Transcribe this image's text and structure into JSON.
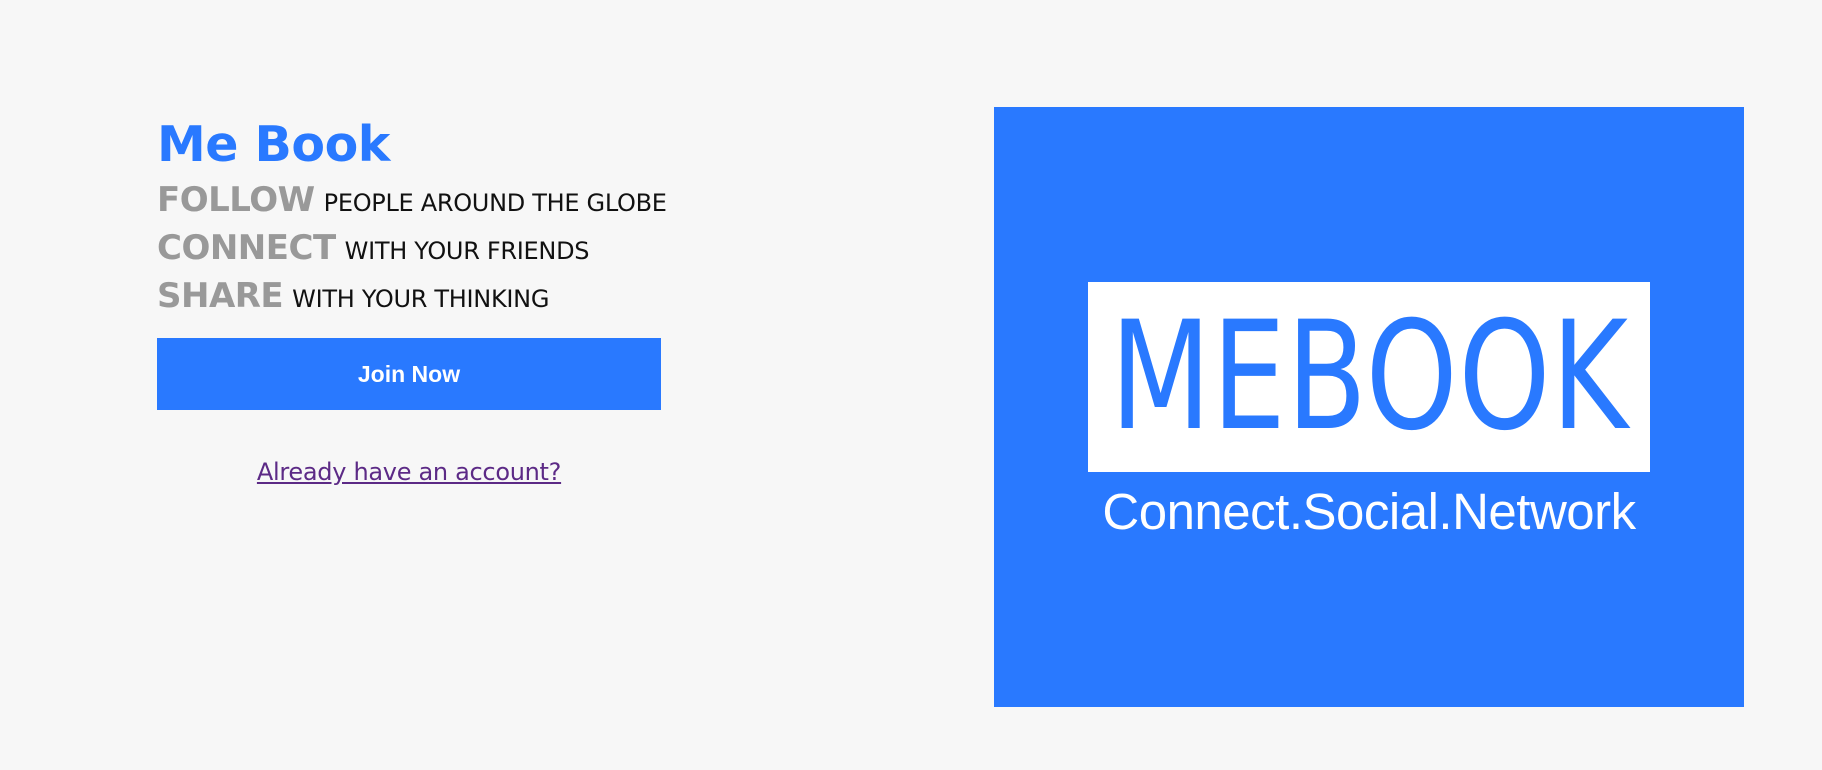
{
  "brand": {
    "title": "Me Book"
  },
  "taglines": [
    {
      "verb": "FOLLOW",
      "rest": "PEOPLE AROUND THE GLOBE"
    },
    {
      "verb": "CONNECT",
      "rest": "WITH YOUR FRIENDS"
    },
    {
      "verb": "SHARE",
      "rest": "WITH YOUR THINKING"
    }
  ],
  "actions": {
    "join_label": "Join Now",
    "login_link": "Already have an account?"
  },
  "logo": {
    "word": "MEBOOK",
    "slogan": "Connect.Social.Network"
  },
  "colors": {
    "accent": "#2979ff",
    "verb_gray": "#999999",
    "link_visited": "#5c2a86",
    "background": "#f7f7f7"
  }
}
